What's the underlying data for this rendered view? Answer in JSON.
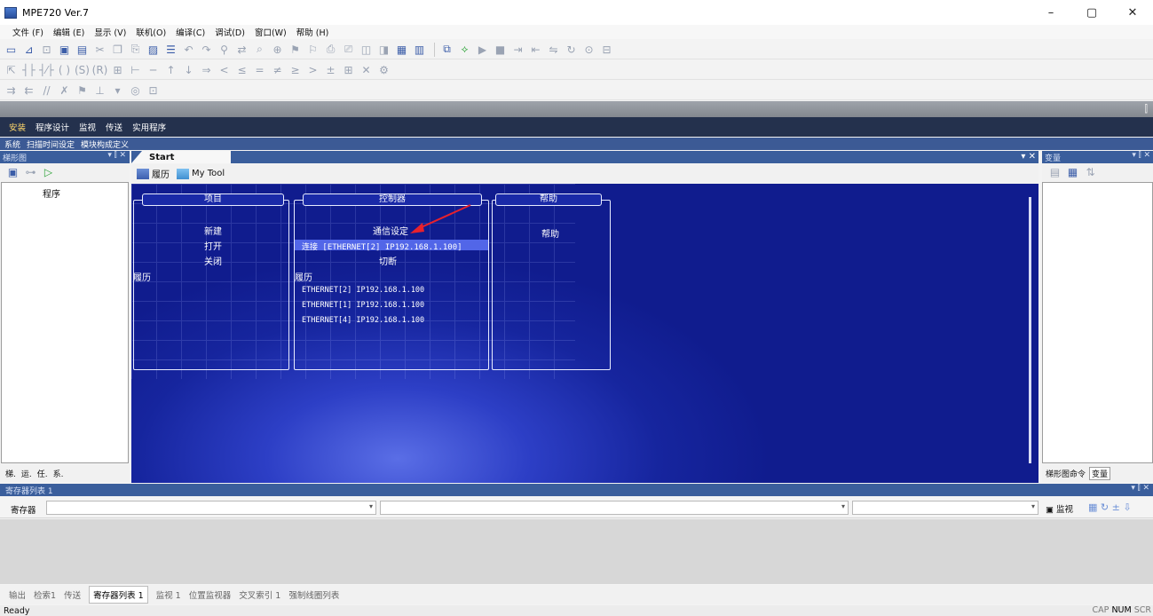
{
  "window": {
    "title": "MPE720 Ver.7",
    "minimize": "–",
    "maximize": "▢",
    "close": "✕"
  },
  "menu": [
    "文件 (F)",
    "编辑 (E)",
    "显示 (V)",
    "联机(O)",
    "编译(C)",
    "调试(D)",
    "窗口(W)",
    "帮助 (H)"
  ],
  "mode_tabs": [
    "安装",
    "程序设计",
    "监视",
    "传送",
    "实用程序"
  ],
  "sub_tabs": [
    "系统",
    "扫描时间设定",
    "模块构成定义"
  ],
  "left_panel": {
    "title": "梯形图",
    "controls": "▾ ⫿ ✕",
    "item": "程序",
    "tabs": [
      "梯.",
      "运.",
      "任.",
      "系."
    ]
  },
  "doc": {
    "tab": "Start",
    "close": "▾ ✕",
    "history_label": "履历",
    "mytool_label": "My Tool"
  },
  "project": {
    "title": "项目",
    "new": "新建",
    "open": "打开",
    "close": "关闭",
    "history": "履历"
  },
  "controller": {
    "title": "控制器",
    "comm_setting": "通信设定",
    "connect": "连接 [ETHERNET[2] IP192.168.1.100]",
    "disconnect": "切断",
    "history": "履历",
    "history_items": [
      "ETHERNET[2] IP192.168.1.100",
      "ETHERNET[1] IP192.168.1.100",
      "ETHERNET[4] IP192.168.1.100"
    ]
  },
  "help": {
    "title": "帮助",
    "link": "帮助"
  },
  "right_panel": {
    "title": "变量",
    "controls": "▾ ⫿ ✕",
    "tabs": [
      "梯形图命令",
      "变量"
    ]
  },
  "register_list": {
    "title": "寄存器列表 1",
    "controls": "▾ ⫿ ✕",
    "label": "寄存器",
    "monitor_label": "监视"
  },
  "bottom_tabs": [
    "输出",
    "检索1",
    "传送",
    "寄存器列表 1",
    "监视 1",
    "位置监视器",
    "交叉索引 1",
    "强制线圈列表"
  ],
  "status": {
    "text": "Ready",
    "indicators": [
      "CAP",
      "NUM",
      "SCR"
    ]
  },
  "colors": {
    "canvas_blue": "#16259e",
    "header_blue": "#3a5e9c",
    "mode_bar": "#24314d",
    "arrow_red": "#e8212d"
  }
}
